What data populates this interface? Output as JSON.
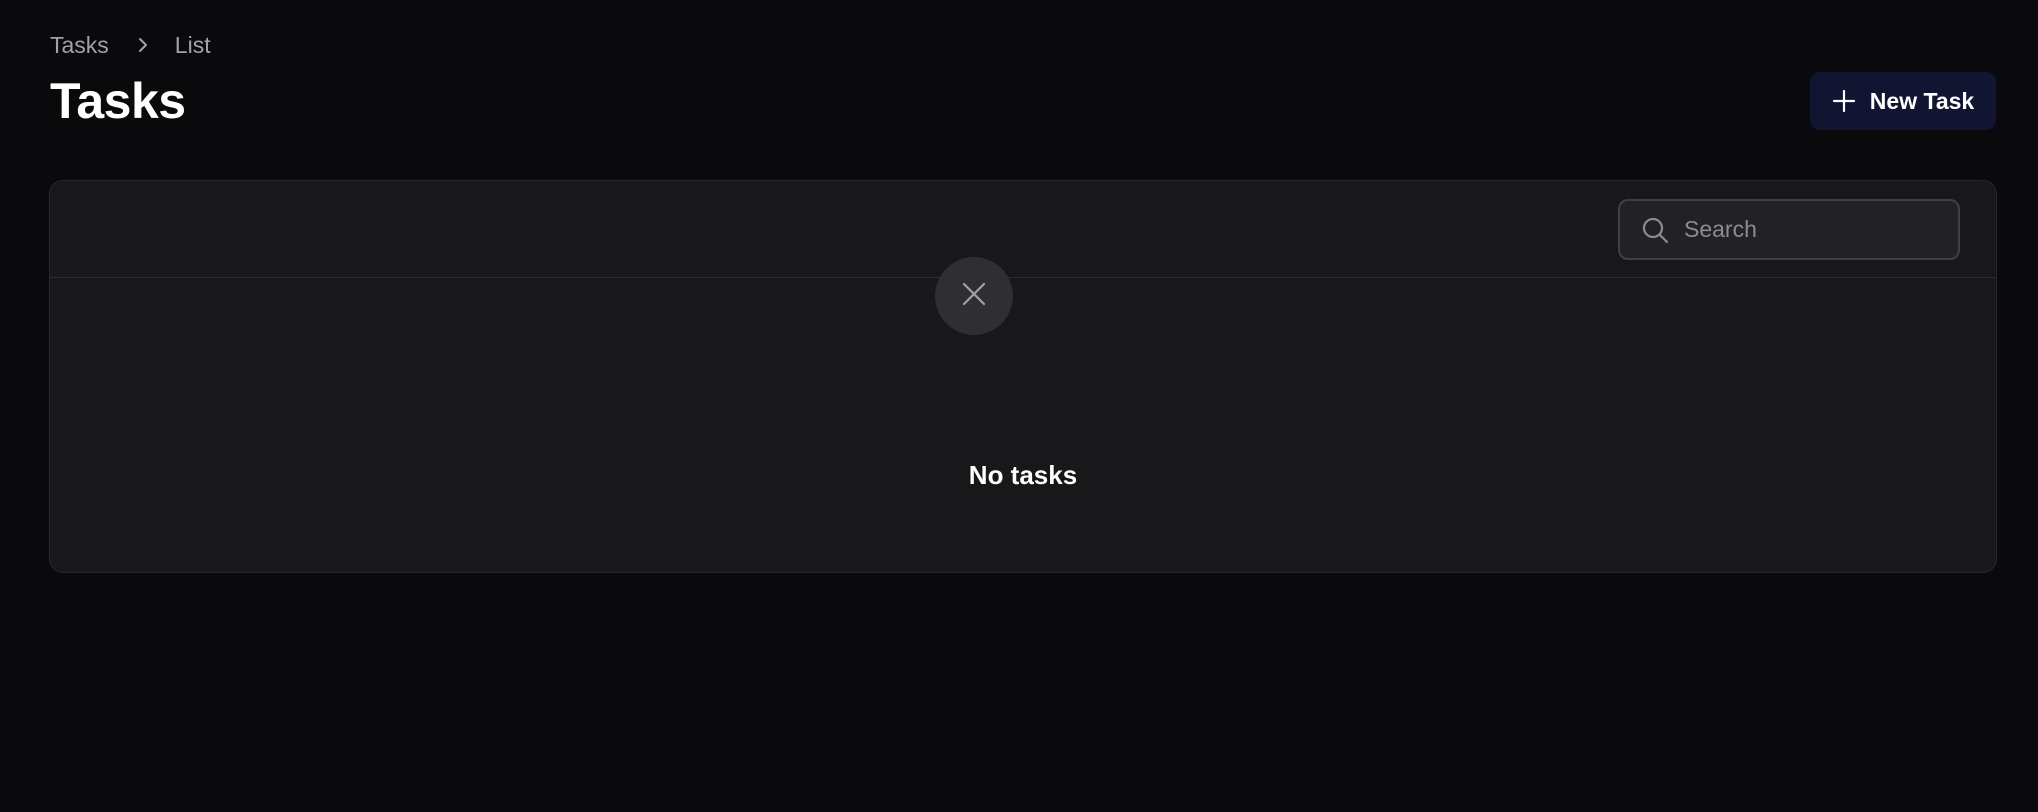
{
  "breadcrumb": {
    "items": [
      "Tasks",
      "List"
    ]
  },
  "header": {
    "title": "Tasks",
    "new_task_label": "New Task"
  },
  "toolbar": {
    "search": {
      "placeholder": "Search",
      "value": ""
    }
  },
  "empty_state": {
    "title": "No tasks",
    "icon": "x-icon"
  },
  "icons": {
    "breadcrumb_separator": "chevron-right-icon",
    "new_task": "plus-icon",
    "search": "search-icon"
  },
  "colors": {
    "background": "#0a0a0c",
    "panel": "#18181b",
    "primary_button": "#111532",
    "muted_text": "#a1a1aa"
  }
}
